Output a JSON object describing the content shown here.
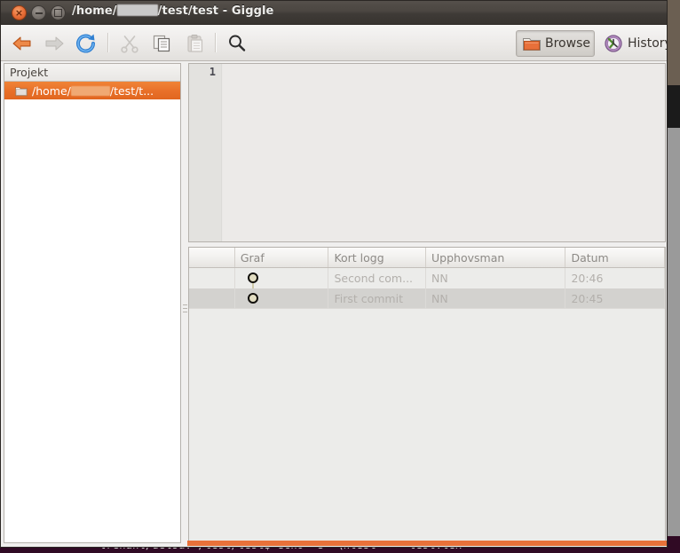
{
  "window": {
    "title_prefix": "/home/",
    "title_suffix": "/test/test - Giggle",
    "app_name": "Giggle",
    "controls": {
      "close": "×",
      "minimize": "−",
      "maximize": "□"
    }
  },
  "toolbar": {
    "back": "back-arrow",
    "forward": "forward-arrow",
    "reload": "reload",
    "cut": "cut",
    "copy": "copy",
    "paste": "paste",
    "search": "search",
    "browse_label": "Browse",
    "history_label": "History"
  },
  "sidebar": {
    "header": "Projekt",
    "items": [
      {
        "label_prefix": "/home/",
        "label_suffix": "/test/t...",
        "selected": true,
        "icon": "folder-icon"
      }
    ]
  },
  "editor": {
    "line_numbers": [
      "1"
    ],
    "lines": [
      ""
    ]
  },
  "commit_table": {
    "columns": [
      "",
      "Graf",
      "Kort logg",
      "Upphovsman",
      "Datum"
    ],
    "rows": [
      {
        "graph": "node",
        "short_log": "Second com...",
        "author": "NN",
        "date": "20:46"
      },
      {
        "graph": "node",
        "short_log": "First commit",
        "author": "NN",
        "date": "20:45"
      }
    ]
  },
  "terminal_behind": {
    "line": "lrenahl/delsa:~/test/test$ echo -e \"\\ntest\" >> test.tex"
  },
  "colors": {
    "accent_orange": "#e8713a",
    "titlebar_dark": "#3f3b37",
    "selection_orange": "#e9712a",
    "window_bg": "#f0efee",
    "row_odd": "#ececea",
    "row_even": "#d3d2cf",
    "graph_node_fill": "#e2ddc2"
  }
}
